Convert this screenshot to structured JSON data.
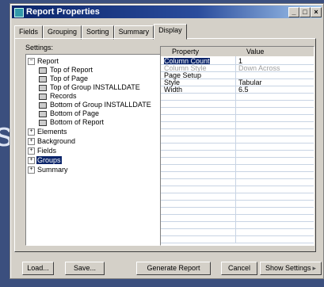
{
  "window": {
    "title": "Report Properties",
    "minimize_label": "_",
    "restore_label": "□",
    "close_label": "×"
  },
  "tabs": [
    {
      "label": "Fields"
    },
    {
      "label": "Grouping"
    },
    {
      "label": "Sorting"
    },
    {
      "label": "Summary"
    },
    {
      "label": "Display"
    }
  ],
  "settings_label": "Settings:",
  "tree": {
    "items": [
      {
        "label": "Report",
        "expander": "−"
      },
      {
        "label": "Top of Report"
      },
      {
        "label": "Top of Page"
      },
      {
        "label": "Top of Group INSTALLDATE"
      },
      {
        "label": "Records"
      },
      {
        "label": "Bottom of Group INSTALLDATE"
      },
      {
        "label": "Bottom of Page"
      },
      {
        "label": "Bottom of Report"
      },
      {
        "label": "Elements",
        "expander": "+"
      },
      {
        "label": "Background",
        "expander": "+"
      },
      {
        "label": "Fields",
        "expander": "+"
      },
      {
        "label": "Groups",
        "expander": "+"
      },
      {
        "label": "Summary",
        "expander": "+"
      }
    ]
  },
  "grid": {
    "headers": {
      "property": "Property",
      "value": "Value"
    },
    "rows": [
      {
        "property": "Column Count",
        "value": "1"
      },
      {
        "property": "Column Style",
        "value": "Down Across"
      },
      {
        "property": "Page Setup",
        "value": ""
      },
      {
        "property": "Style",
        "value": "Tabular"
      },
      {
        "property": "Width",
        "value": "6.5"
      }
    ]
  },
  "buttons": {
    "load": "Load...",
    "save": "Save...",
    "generate": "Generate Report",
    "cancel": "Cancel",
    "show_settings": "Show Settings",
    "show_settings_arrow": "▸"
  },
  "background_glyph": "s)",
  "colors": {
    "desktop": "#3b4f7e",
    "titlebar": "#0a246a",
    "selection": "#0a246a",
    "face": "#d4d0c8"
  }
}
